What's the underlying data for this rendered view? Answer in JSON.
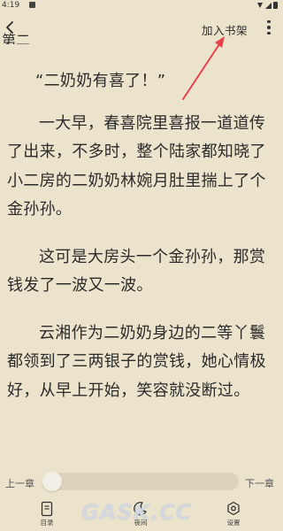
{
  "status_bar": {
    "time": "4:19"
  },
  "toolbar": {
    "add_to_shelf": "加入书架"
  },
  "reader": {
    "cut_off_line": "第二",
    "paragraphs": [
      "“二奶奶有喜了！”",
      "一大早，春喜院里喜报一道道传了出来，不多时，整个陆家都知晓了小二房的二奶奶林婉月肚里揣上了个金孙孙。",
      "这可是大房头一个金孙孙，那赏钱发了一波又一波。",
      "云湘作为二奶奶身边的二等丫鬟都领到了三两银子的赏钱，她心情极好，从早上开始，笑容就没断过。"
    ]
  },
  "chapter_nav": {
    "prev_label": "上一章",
    "next_label": "下一章",
    "progress": 0
  },
  "bottom_nav": {
    "catalog_label": "目录",
    "night_label": "夜间",
    "settings_label": "设置"
  },
  "watermark": {
    "text": "GASK.CC"
  },
  "colors": {
    "background": "#ece3cc",
    "text": "#2b2b2b",
    "annotation_arrow": "#e8404a"
  },
  "icons": [
    "back-arrow-icon",
    "more-vertical-icon",
    "catalog-icon",
    "moon-icon",
    "settings-icon"
  ]
}
